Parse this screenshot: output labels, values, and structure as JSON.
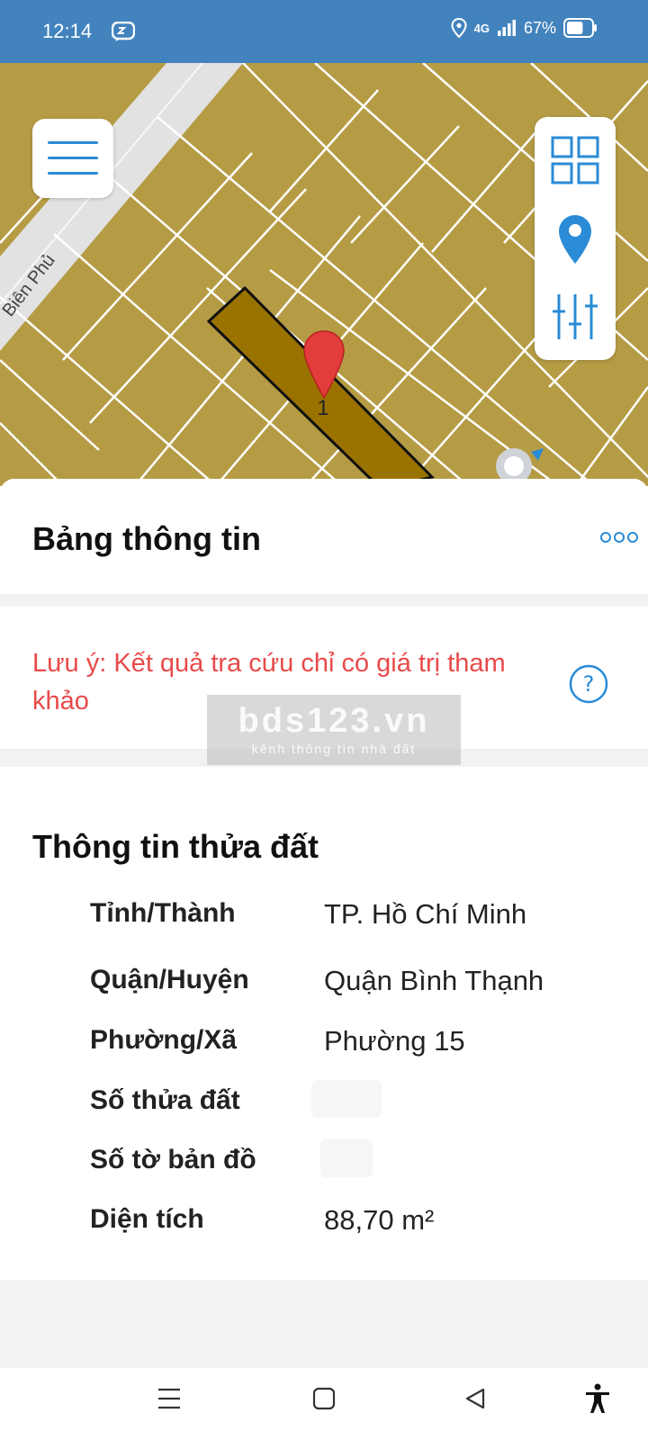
{
  "status_bar": {
    "time": "12:14",
    "network": "4G",
    "battery": "67%",
    "battery_level": 0.67
  },
  "map": {
    "street_label": "Biên Phủ",
    "pin_label": "1",
    "parcel_color": "#9a7200",
    "land_color": "#b59c44"
  },
  "toolbar": {
    "menu_icon": "hamburger-menu-icon",
    "layers_icon": "grid-layers-icon",
    "location_icon": "map-pin-icon",
    "filter_icon": "sliders-icon"
  },
  "panel": {
    "title": "Bảng thông tin",
    "more_icon": "more-dots-icon"
  },
  "note": {
    "text": "Lưu ý: Kết quả tra cứu chỉ có giá trị tham khảo",
    "help_icon": "help-circle-icon"
  },
  "watermark": {
    "main": "bds123.vn",
    "sub": "kênh thông tin nhà đất"
  },
  "parcel_info": {
    "title": "Thông tin thửa đất",
    "rows": [
      {
        "label": "Tỉnh/Thành",
        "value": "TP. Hồ Chí Minh"
      },
      {
        "label": "Quận/Huyện",
        "value": "Quận Bình Thạnh"
      },
      {
        "label": "Phường/Xã",
        "value": "Phường 15"
      },
      {
        "label": "Số thửa đất",
        "value": ""
      },
      {
        "label": "Số tờ bản đồ",
        "value": ""
      },
      {
        "label": "Diện tích",
        "value": "88,70 m²"
      }
    ]
  },
  "accent_color": "#2a8bd6",
  "warning_color": "#e84a4a"
}
